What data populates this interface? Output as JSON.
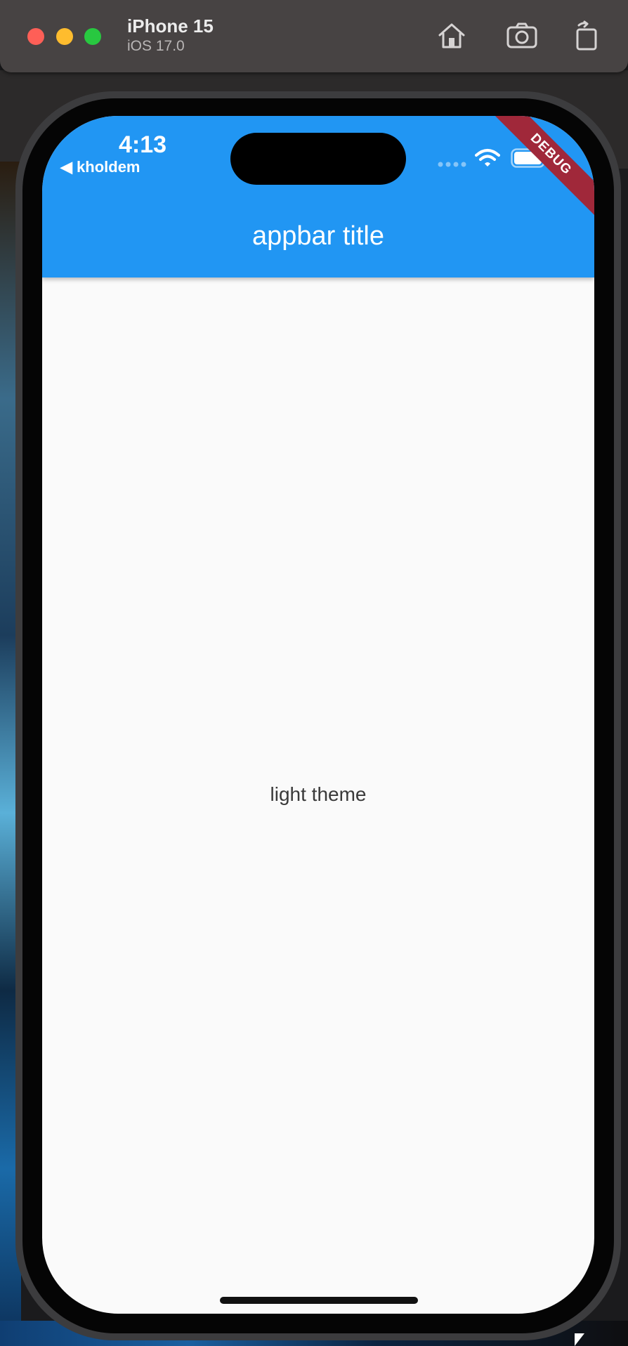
{
  "simulator": {
    "device_name": "iPhone 15",
    "os_version": "iOS 17.0",
    "toolbar_icons": [
      "home-icon",
      "screenshot-icon",
      "rotate-icon"
    ],
    "traffic_lights": {
      "close": "#fe5f57",
      "minimize": "#febc2e",
      "zoom": "#28c840"
    }
  },
  "status_bar": {
    "time": "4:13",
    "back_app": "◀ kholdem",
    "icons": [
      "signal-icon",
      "wifi-icon",
      "battery-icon"
    ]
  },
  "appbar": {
    "title": "appbar title",
    "color": "#2196f3"
  },
  "debug_banner": "DEBUG",
  "body": {
    "text": "light theme",
    "background": "#fafafa"
  }
}
